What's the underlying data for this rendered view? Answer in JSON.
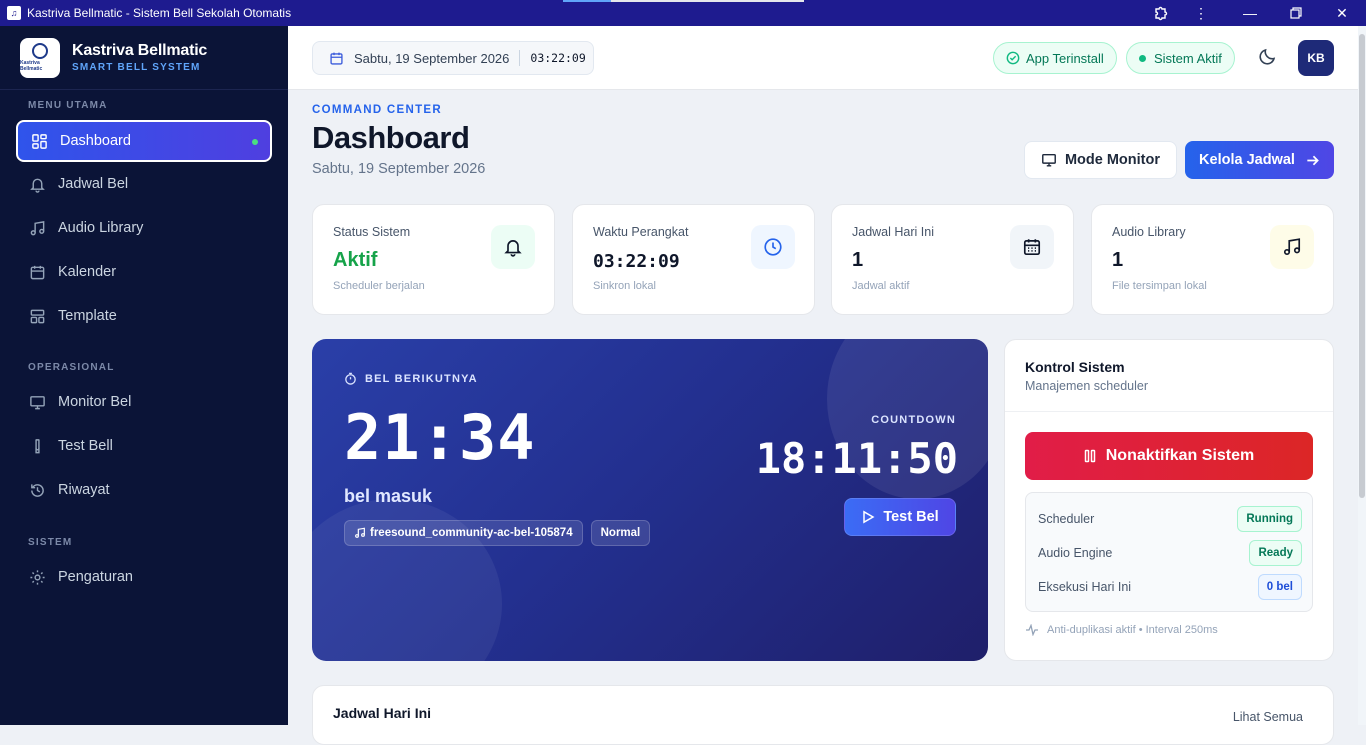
{
  "window": {
    "title": "Kastriva Bellmatic - Sistem Bell Sekolah Otomatis"
  },
  "brand": {
    "name": "Kastriva Bellmatic",
    "tagline": "SMART BELL SYSTEM",
    "logo_text": "Kastriva Bellmatic"
  },
  "sidebar": {
    "sections": [
      "MENU UTAMA",
      "OPERASIONAL",
      "SISTEM"
    ],
    "items": [
      {
        "label": "Dashboard",
        "icon": "grid-icon",
        "active": true
      },
      {
        "label": "Jadwal Bel",
        "icon": "bell-icon"
      },
      {
        "label": "Audio Library",
        "icon": "music-icon"
      },
      {
        "label": "Kalender",
        "icon": "calendar-icon"
      },
      {
        "label": "Template",
        "icon": "layout-icon"
      },
      {
        "label": "Monitor Bel",
        "icon": "monitor-icon"
      },
      {
        "label": "Test Bell",
        "icon": "test-icon"
      },
      {
        "label": "Riwayat",
        "icon": "history-icon"
      },
      {
        "label": "Pengaturan",
        "icon": "gear-icon"
      }
    ]
  },
  "topbar": {
    "date": "Sabtu, 19 September 2026",
    "time": "03:22:09",
    "app_installed": "App Terinstall",
    "system_active": "Sistem Aktif",
    "avatar": "KB"
  },
  "header": {
    "eyebrow": "COMMAND CENTER",
    "title": "Dashboard",
    "date": "Sabtu, 19 September 2026",
    "monitor_button": "Mode Monitor",
    "manage_button": "Kelola Jadwal"
  },
  "stats": [
    {
      "label": "Status Sistem",
      "value": "Aktif",
      "sub": "Scheduler berjalan",
      "icon": "bell-icon",
      "color": "#16a34a"
    },
    {
      "label": "Waktu Perangkat",
      "value": "03:22:09",
      "sub": "Sinkron lokal",
      "icon": "clock-icon",
      "color": "#2563eb"
    },
    {
      "label": "Jadwal Hari Ini",
      "value": "1",
      "sub": "Jadwal aktif",
      "icon": "calendar-icon",
      "color": "#334155"
    },
    {
      "label": "Audio Library",
      "value": "1",
      "sub": "File tersimpan lokal",
      "icon": "music-icon",
      "color": "#b45309"
    }
  ],
  "next_bell": {
    "label": "BEL BERIKUTNYA",
    "time": "21:34",
    "name": "bel masuk",
    "audio": "freesound_community-ac-bel-105874",
    "mode": "Normal",
    "countdown_label": "COUNTDOWN",
    "countdown": "18:11:50",
    "test_button": "Test Bel"
  },
  "control": {
    "title": "Kontrol Sistem",
    "subtitle": "Manajemen scheduler",
    "disable_button": "Nonaktifkan Sistem",
    "rows": [
      {
        "label": "Scheduler",
        "badge": "Running"
      },
      {
        "label": "Audio Engine",
        "badge": "Ready"
      },
      {
        "label": "Eksekusi Hari Ini",
        "badge": "0 bel"
      }
    ],
    "footer": "Anti-duplikasi aktif • Interval 250ms"
  },
  "schedule": {
    "title": "Jadwal Hari Ini",
    "see_all": "Lihat Semua"
  },
  "colors": {
    "accent": "#2563eb",
    "sidebar": "#0b1437",
    "danger": "#dc2626",
    "success": "#16a34a"
  }
}
